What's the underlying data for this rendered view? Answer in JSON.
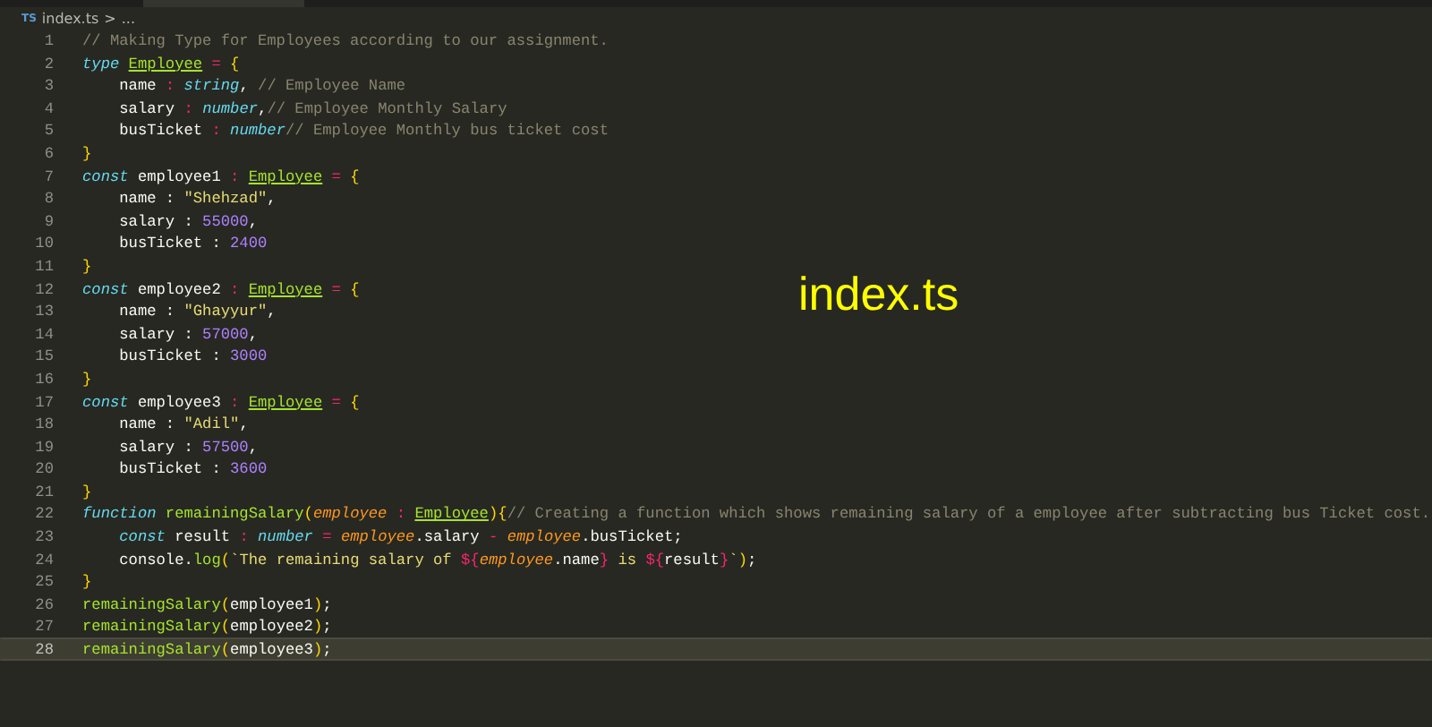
{
  "breadcrumb": {
    "file_badge": "TS",
    "file": "index.ts",
    "separator": ">",
    "more": "..."
  },
  "overlay_title": "index.ts",
  "lines": [
    {
      "number": "1",
      "current": false,
      "tokens": [
        {
          "text": "// Making Type for Employees according to our assignment.",
          "kind": "cm"
        }
      ]
    },
    {
      "number": "2",
      "current": false,
      "tokens": [
        {
          "text": "type ",
          "kind": "kw"
        },
        {
          "text": "Employee",
          "kind": "ty"
        },
        {
          "text": " = ",
          "kind": "op"
        },
        {
          "text": "{",
          "kind": "br"
        }
      ]
    },
    {
      "number": "3",
      "current": false,
      "tokens": [
        {
          "text": "    name",
          "kind": "pl"
        },
        {
          "text": " : ",
          "kind": "op"
        },
        {
          "text": "string",
          "kind": "kw"
        },
        {
          "text": ", ",
          "kind": "pl"
        },
        {
          "text": "// Employee Name",
          "kind": "cm"
        }
      ]
    },
    {
      "number": "4",
      "current": false,
      "tokens": [
        {
          "text": "    salary",
          "kind": "pl"
        },
        {
          "text": " : ",
          "kind": "op"
        },
        {
          "text": "number",
          "kind": "kw"
        },
        {
          "text": ",",
          "kind": "pl"
        },
        {
          "text": "// Employee Monthly Salary",
          "kind": "cm"
        }
      ]
    },
    {
      "number": "5",
      "current": false,
      "tokens": [
        {
          "text": "    busTicket",
          "kind": "pl"
        },
        {
          "text": " : ",
          "kind": "op"
        },
        {
          "text": "number",
          "kind": "kw"
        },
        {
          "text": "// Employee Monthly bus ticket cost",
          "kind": "cm"
        }
      ]
    },
    {
      "number": "6",
      "current": false,
      "tokens": [
        {
          "text": "}",
          "kind": "br"
        }
      ]
    },
    {
      "number": "7",
      "current": false,
      "tokens": [
        {
          "text": "const ",
          "kind": "kw"
        },
        {
          "text": "employee1",
          "kind": "pl"
        },
        {
          "text": " : ",
          "kind": "op"
        },
        {
          "text": "Employee",
          "kind": "ty"
        },
        {
          "text": " = ",
          "kind": "op"
        },
        {
          "text": "{",
          "kind": "br"
        }
      ]
    },
    {
      "number": "8",
      "current": false,
      "tokens": [
        {
          "text": "    name : ",
          "kind": "pl"
        },
        {
          "text": "\"Shehzad\"",
          "kind": "str"
        },
        {
          "text": ",",
          "kind": "pl"
        }
      ]
    },
    {
      "number": "9",
      "current": false,
      "tokens": [
        {
          "text": "    salary : ",
          "kind": "pl"
        },
        {
          "text": "55000",
          "kind": "num"
        },
        {
          "text": ",",
          "kind": "pl"
        }
      ]
    },
    {
      "number": "10",
      "current": false,
      "tokens": [
        {
          "text": "    busTicket : ",
          "kind": "pl"
        },
        {
          "text": "2400",
          "kind": "num"
        }
      ]
    },
    {
      "number": "11",
      "current": false,
      "tokens": [
        {
          "text": "}",
          "kind": "br"
        }
      ]
    },
    {
      "number": "12",
      "current": false,
      "tokens": [
        {
          "text": "const ",
          "kind": "kw"
        },
        {
          "text": "employee2",
          "kind": "pl"
        },
        {
          "text": " : ",
          "kind": "op"
        },
        {
          "text": "Employee",
          "kind": "ty"
        },
        {
          "text": " = ",
          "kind": "op"
        },
        {
          "text": "{",
          "kind": "br"
        }
      ]
    },
    {
      "number": "13",
      "current": false,
      "tokens": [
        {
          "text": "    name : ",
          "kind": "pl"
        },
        {
          "text": "\"Ghayyur\"",
          "kind": "str"
        },
        {
          "text": ",",
          "kind": "pl"
        }
      ]
    },
    {
      "number": "14",
      "current": false,
      "tokens": [
        {
          "text": "    salary : ",
          "kind": "pl"
        },
        {
          "text": "57000",
          "kind": "num"
        },
        {
          "text": ",",
          "kind": "pl"
        }
      ]
    },
    {
      "number": "15",
      "current": false,
      "tokens": [
        {
          "text": "    busTicket : ",
          "kind": "pl"
        },
        {
          "text": "3000",
          "kind": "num"
        }
      ]
    },
    {
      "number": "16",
      "current": false,
      "tokens": [
        {
          "text": "}",
          "kind": "br"
        }
      ]
    },
    {
      "number": "17",
      "current": false,
      "tokens": [
        {
          "text": "const ",
          "kind": "kw"
        },
        {
          "text": "employee3",
          "kind": "pl"
        },
        {
          "text": " : ",
          "kind": "op"
        },
        {
          "text": "Employee",
          "kind": "ty"
        },
        {
          "text": " = ",
          "kind": "op"
        },
        {
          "text": "{",
          "kind": "br"
        }
      ]
    },
    {
      "number": "18",
      "current": false,
      "tokens": [
        {
          "text": "    name : ",
          "kind": "pl"
        },
        {
          "text": "\"Adil\"",
          "kind": "str"
        },
        {
          "text": ",",
          "kind": "pl"
        }
      ]
    },
    {
      "number": "19",
      "current": false,
      "tokens": [
        {
          "text": "    salary : ",
          "kind": "pl"
        },
        {
          "text": "57500",
          "kind": "num"
        },
        {
          "text": ",",
          "kind": "pl"
        }
      ]
    },
    {
      "number": "20",
      "current": false,
      "tokens": [
        {
          "text": "    busTicket : ",
          "kind": "pl"
        },
        {
          "text": "3600",
          "kind": "num"
        }
      ]
    },
    {
      "number": "21",
      "current": false,
      "tokens": [
        {
          "text": "}",
          "kind": "br"
        }
      ]
    },
    {
      "number": "22",
      "current": false,
      "tokens": [
        {
          "text": "function ",
          "kind": "kw"
        },
        {
          "text": "remainingSalary",
          "kind": "fn"
        },
        {
          "text": "(",
          "kind": "br"
        },
        {
          "text": "employee",
          "kind": "par"
        },
        {
          "text": " : ",
          "kind": "op"
        },
        {
          "text": "Employee",
          "kind": "ty"
        },
        {
          "text": ")",
          "kind": "br"
        },
        {
          "text": "{",
          "kind": "br"
        },
        {
          "text": "// Creating a function which shows remaining salary of a employee after subtracting bus Ticket cost.",
          "kind": "cm"
        }
      ]
    },
    {
      "number": "23",
      "current": false,
      "tokens": [
        {
          "text": "    const ",
          "kind": "kw"
        },
        {
          "text": "result",
          "kind": "pl"
        },
        {
          "text": " : ",
          "kind": "op"
        },
        {
          "text": "number",
          "kind": "kw"
        },
        {
          "text": " = ",
          "kind": "op"
        },
        {
          "text": "employee",
          "kind": "par"
        },
        {
          "text": ".salary",
          "kind": "pl"
        },
        {
          "text": " - ",
          "kind": "op"
        },
        {
          "text": "employee",
          "kind": "par"
        },
        {
          "text": ".busTicket;",
          "kind": "pl"
        }
      ]
    },
    {
      "number": "24",
      "current": false,
      "tokens": [
        {
          "text": "    console.",
          "kind": "pl"
        },
        {
          "text": "log",
          "kind": "fn"
        },
        {
          "text": "(",
          "kind": "br"
        },
        {
          "text": "`The remaining salary of ",
          "kind": "str"
        },
        {
          "text": "${",
          "kind": "tpl"
        },
        {
          "text": "employee",
          "kind": "par"
        },
        {
          "text": ".name",
          "kind": "pl"
        },
        {
          "text": "}",
          "kind": "tpl"
        },
        {
          "text": " is ",
          "kind": "str"
        },
        {
          "text": "${",
          "kind": "tpl"
        },
        {
          "text": "result",
          "kind": "pl"
        },
        {
          "text": "}",
          "kind": "tpl"
        },
        {
          "text": "`",
          "kind": "str"
        },
        {
          "text": ")",
          "kind": "br"
        },
        {
          "text": ";",
          "kind": "pl"
        }
      ]
    },
    {
      "number": "25",
      "current": false,
      "tokens": [
        {
          "text": "}",
          "kind": "br"
        }
      ]
    },
    {
      "number": "26",
      "current": false,
      "tokens": [
        {
          "text": "remainingSalary",
          "kind": "fn"
        },
        {
          "text": "(",
          "kind": "br"
        },
        {
          "text": "employee1",
          "kind": "pl"
        },
        {
          "text": ")",
          "kind": "br"
        },
        {
          "text": ";",
          "kind": "pl"
        }
      ]
    },
    {
      "number": "27",
      "current": false,
      "tokens": [
        {
          "text": "remainingSalary",
          "kind": "fn"
        },
        {
          "text": "(",
          "kind": "br"
        },
        {
          "text": "employee2",
          "kind": "pl"
        },
        {
          "text": ")",
          "kind": "br"
        },
        {
          "text": ";",
          "kind": "pl"
        }
      ]
    },
    {
      "number": "28",
      "current": true,
      "tokens": [
        {
          "text": "remainingSalary",
          "kind": "fn"
        },
        {
          "text": "(",
          "kind": "br"
        },
        {
          "text": "employee3",
          "kind": "pl"
        },
        {
          "text": ")",
          "kind": "br"
        },
        {
          "text": ";",
          "kind": "pl"
        }
      ]
    }
  ]
}
